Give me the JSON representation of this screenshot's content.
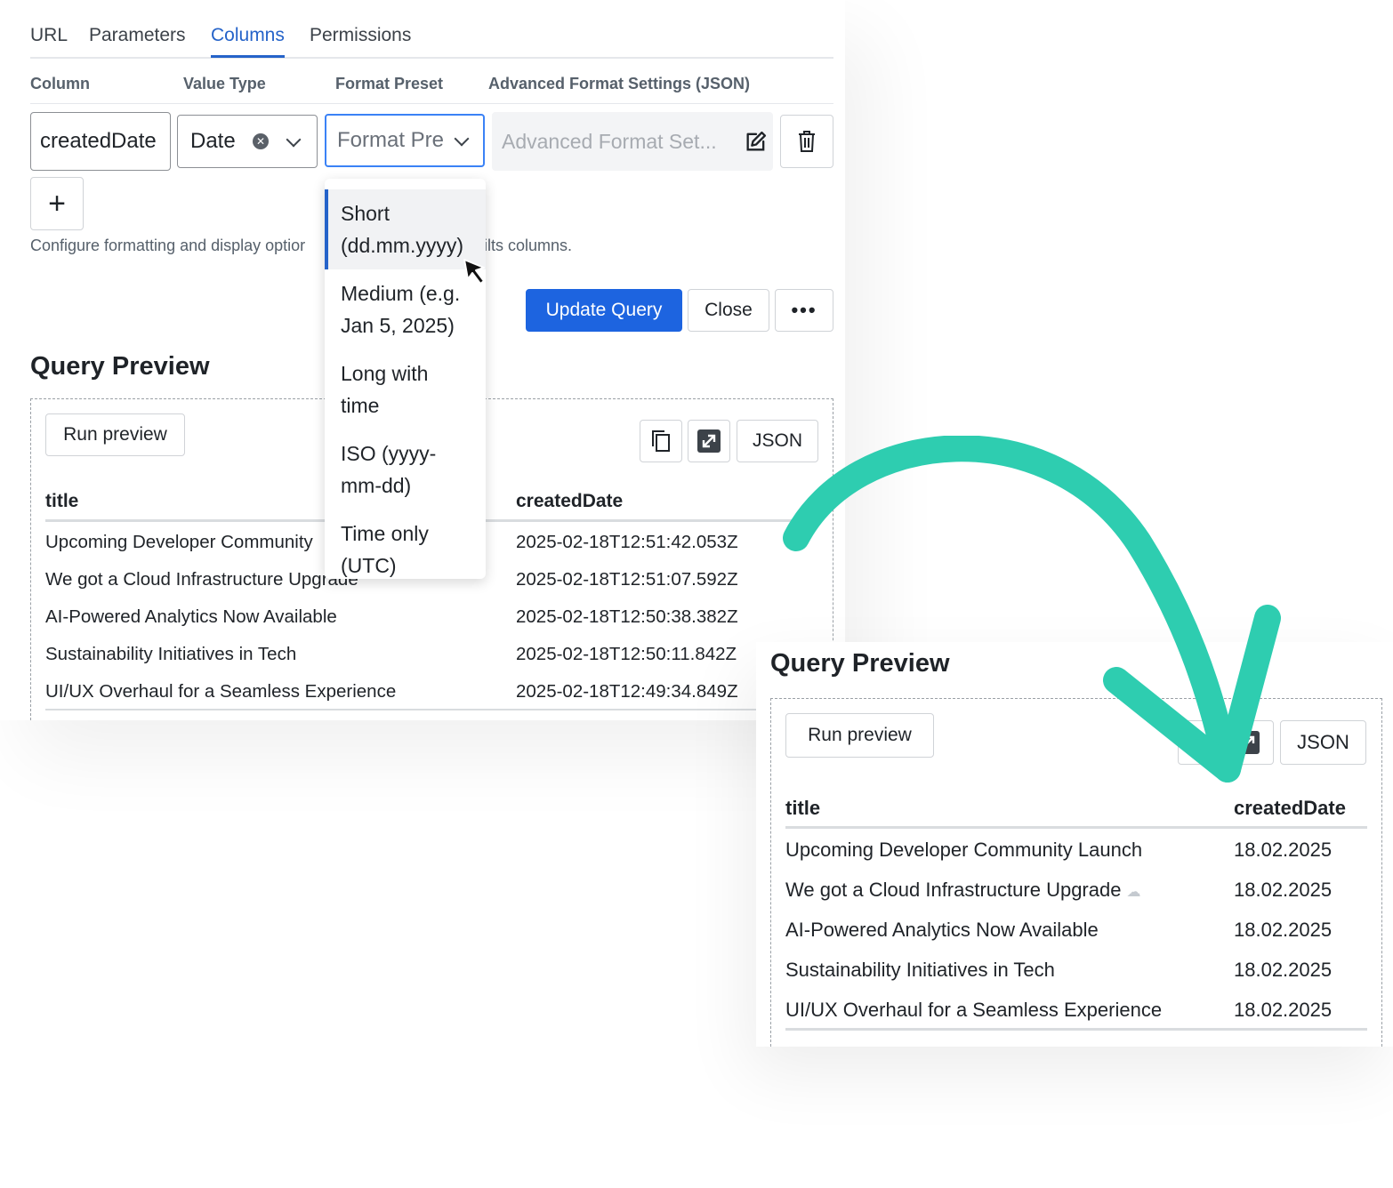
{
  "tabs": [
    "URL",
    "Parameters",
    "Columns",
    "Permissions"
  ],
  "active_tab": "Columns",
  "column_headers": [
    "Column",
    "Value Type",
    "Format Preset",
    "Advanced Format Settings (JSON)"
  ],
  "column_row": {
    "column_value": "createdDate",
    "value_type": "Date",
    "format_preset_placeholder": "Format Pre",
    "advanced_placeholder": "Advanced Format Set..."
  },
  "add_label": "+",
  "help_text_prefix": "Configure formatting and display optior",
  "help_text_suffix": "ilts columns.",
  "actions": {
    "update": "Update Query",
    "close": "Close",
    "more": "•••"
  },
  "dropdown_options": [
    {
      "line1": "Short",
      "line2": "(dd.mm.yyyy)"
    },
    {
      "line1": "Medium (e.g.",
      "line2": "Jan 5, 2025)"
    },
    {
      "line1": "Long with",
      "line2": "time"
    },
    {
      "line1": "ISO (yyyy-",
      "line2": "mm-dd)"
    },
    {
      "line1": "Time only",
      "line2": "(UTC)"
    }
  ],
  "preview_main": {
    "title": "Query Preview",
    "run_label": "Run preview",
    "json_label": "JSON",
    "headers": [
      "title",
      "createdDate"
    ],
    "rows": [
      {
        "title": "Upcoming Developer Community",
        "date": "2025-02-18T12:51:42.053Z"
      },
      {
        "title": "We got a Cloud Infrastructure Upgrade",
        "date": "2025-02-18T12:51:07.592Z"
      },
      {
        "title": "AI-Powered Analytics Now Available",
        "date": "2025-02-18T12:50:38.382Z"
      },
      {
        "title": "Sustainability Initiatives in Tech",
        "date": "2025-02-18T12:50:11.842Z"
      },
      {
        "title": "UI/UX Overhaul for a Seamless Experience",
        "date": "2025-02-18T12:49:34.849Z"
      }
    ]
  },
  "preview_second": {
    "title": "Query Preview",
    "run_label": "Run preview",
    "json_label": "JSON",
    "headers": [
      "title",
      "createdDate"
    ],
    "rows": [
      {
        "title": "Upcoming Developer Community Launch",
        "date": "18.02.2025"
      },
      {
        "title": "We got a Cloud Infrastructure Upgrade",
        "date": "18.02.2025"
      },
      {
        "title": "AI-Powered Analytics Now Available",
        "date": "18.02.2025"
      },
      {
        "title": "Sustainability Initiatives in Tech",
        "date": "18.02.2025"
      },
      {
        "title": "UI/UX Overhaul for a Seamless Experience",
        "date": "18.02.2025"
      }
    ]
  },
  "colors": {
    "accent": "#1d64e0",
    "arrow": "#2ecdb0"
  }
}
